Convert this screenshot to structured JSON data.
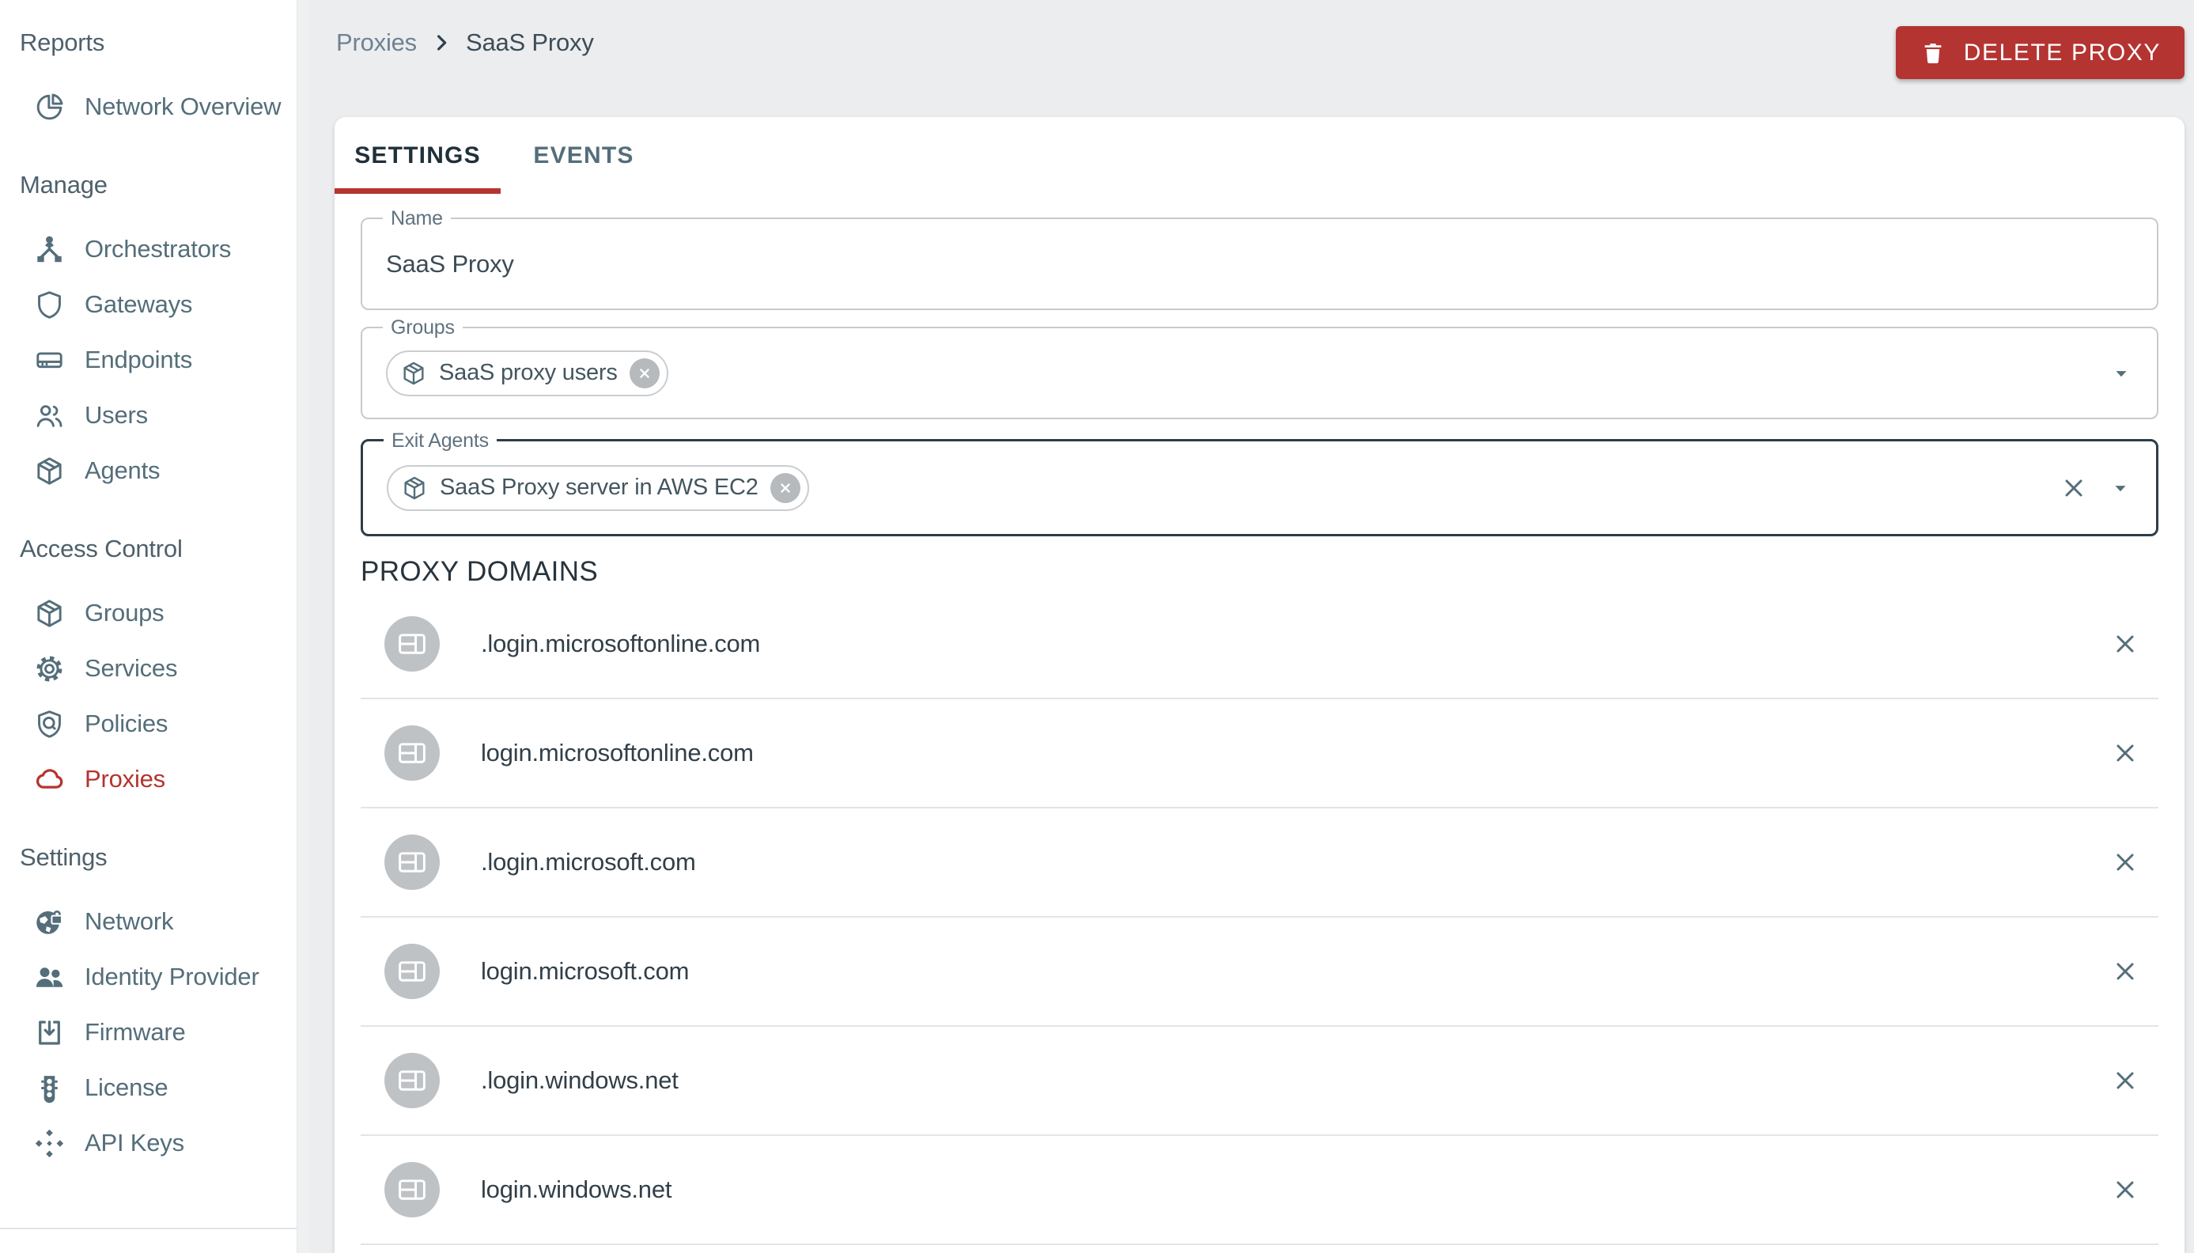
{
  "sidebar": {
    "sections": [
      {
        "header": "Reports",
        "items": [
          {
            "label": "Network Overview",
            "icon": "pie-chart-icon",
            "active": false
          }
        ]
      },
      {
        "header": "Manage",
        "items": [
          {
            "label": "Orchestrators",
            "icon": "orchestrator-icon",
            "active": false
          },
          {
            "label": "Gateways",
            "icon": "shield-icon",
            "active": false
          },
          {
            "label": "Endpoints",
            "icon": "device-icon",
            "active": false
          },
          {
            "label": "Users",
            "icon": "users-icon",
            "active": false
          },
          {
            "label": "Agents",
            "icon": "package-icon",
            "active": false
          }
        ]
      },
      {
        "header": "Access Control",
        "items": [
          {
            "label": "Groups",
            "icon": "cube-icon",
            "active": false
          },
          {
            "label": "Services",
            "icon": "gear-icon",
            "active": false
          },
          {
            "label": "Policies",
            "icon": "shield-search-icon",
            "active": false
          },
          {
            "label": "Proxies",
            "icon": "cloud-icon",
            "active": true
          }
        ]
      },
      {
        "header": "Settings",
        "items": [
          {
            "label": "Network",
            "icon": "globe-lock-icon",
            "active": false
          },
          {
            "label": "Identity Provider",
            "icon": "people-icon",
            "active": false
          },
          {
            "label": "Firmware",
            "icon": "download-icon",
            "active": false
          },
          {
            "label": "License",
            "icon": "traffic-light-icon",
            "active": false
          },
          {
            "label": "API Keys",
            "icon": "api-keys-icon",
            "active": false
          }
        ]
      }
    ]
  },
  "header": {
    "breadcrumb": [
      "Proxies",
      "SaaS Proxy"
    ],
    "delete_label": "DELETE PROXY"
  },
  "tabs": [
    {
      "label": "SETTINGS",
      "active": true
    },
    {
      "label": "EVENTS",
      "active": false
    }
  ],
  "form": {
    "name": {
      "label": "Name",
      "value": "SaaS Proxy"
    },
    "groups": {
      "label": "Groups",
      "chips": [
        {
          "label": "SaaS proxy users",
          "icon": "cube-icon"
        }
      ]
    },
    "exit_agents": {
      "label": "Exit Agents",
      "chips": [
        {
          "label": "SaaS Proxy server in AWS EC2",
          "icon": "cube-icon"
        }
      ]
    }
  },
  "domains": {
    "heading": "PROXY DOMAINS",
    "items": [
      ".login.microsoftonline.com",
      "login.microsoftonline.com",
      ".login.microsoft.com",
      "login.microsoft.com",
      ".login.windows.net",
      "login.windows.net"
    ]
  },
  "colors": {
    "accent_red": "#b5342f",
    "sidebar_text": "#546e7a",
    "page_background": "#ecedef",
    "focused_border": "#2e3d46",
    "avatar_gray": "#bfc2c5"
  }
}
